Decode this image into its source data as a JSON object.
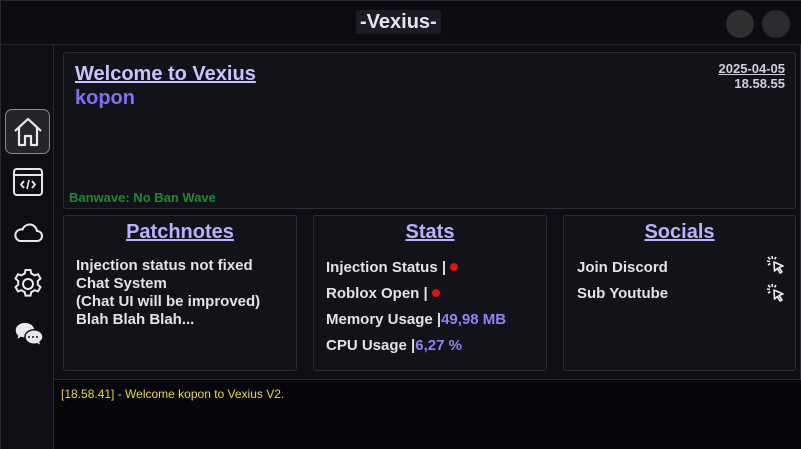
{
  "window": {
    "title": "-Vexius-"
  },
  "sidebar": {
    "items": [
      {
        "name": "home",
        "icon": "home-icon",
        "active": true
      },
      {
        "name": "editor",
        "icon": "code-window-icon",
        "active": false
      },
      {
        "name": "cloud",
        "icon": "cloud-icon",
        "active": false
      },
      {
        "name": "settings",
        "icon": "gear-icon",
        "active": false
      },
      {
        "name": "chat",
        "icon": "chat-bubbles-icon",
        "active": false
      }
    ]
  },
  "welcome": {
    "title": "Welcome to Vexius",
    "username": "kopon",
    "date": "2025-04-05",
    "time": "18.58.55",
    "banwave": "Banwave: No Ban Wave"
  },
  "patchnotes": {
    "title": "Patchnotes",
    "lines": [
      "Injection status not fixed",
      "Chat System",
      "(Chat UI will be improved)",
      "Blah Blah Blah..."
    ]
  },
  "stats": {
    "title": "Stats",
    "injection_label": "Injection Status |",
    "roblox_label": "Roblox Open |",
    "memory_label": "Memory Usage |",
    "memory_value": "49,98 MB",
    "cpu_label": "CPU Usage |",
    "cpu_value": "6,27 %",
    "status_color": "#e01010"
  },
  "socials": {
    "title": "Socials",
    "discord_label": "Join Discord",
    "youtube_label": "Sub Youtube",
    "icon": "click-cursor-icon"
  },
  "console": {
    "line": "[18.58.41] - Welcome kopon to Vexius V2."
  },
  "colors": {
    "accent": "#7d72f2",
    "accent_light": "#b9b2ff",
    "banwave": "#1d8a2a",
    "console_text": "#e6d54a"
  }
}
